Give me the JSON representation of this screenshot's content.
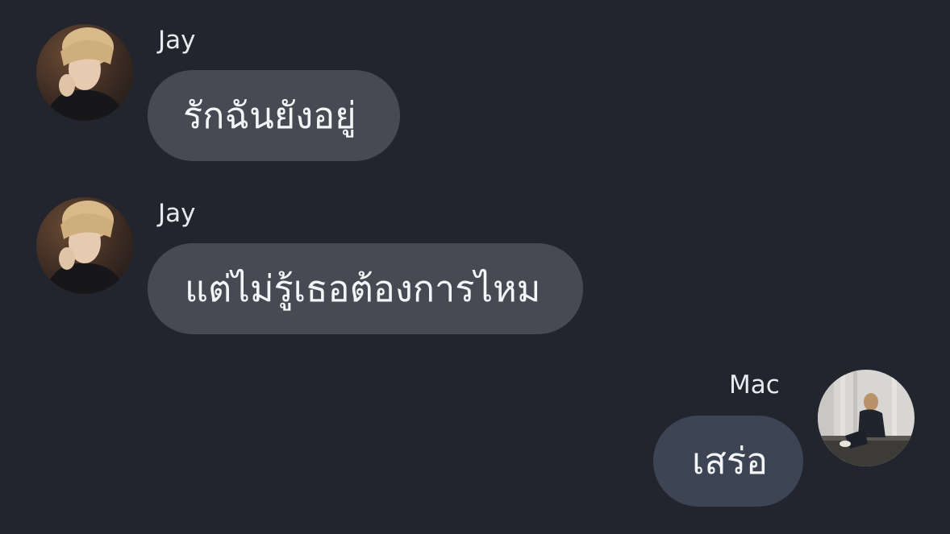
{
  "colors": {
    "background": "#22252d",
    "incoming_bubble": "#474a53",
    "outgoing_bubble": "#3d4554",
    "text": "#f4f5f7",
    "name_text": "#e9eaee"
  },
  "messages": [
    {
      "sender": "Jay",
      "text": "รักฉันยังอยู่",
      "direction": "incoming",
      "avatar_icon": "jay-avatar"
    },
    {
      "sender": "Jay",
      "text": "แต่ไม่รู้เธอต้องการไหม",
      "direction": "incoming",
      "avatar_icon": "jay-avatar"
    },
    {
      "sender": "Mac",
      "text": "เสร่อ",
      "direction": "outgoing",
      "avatar_icon": "mac-avatar"
    }
  ]
}
